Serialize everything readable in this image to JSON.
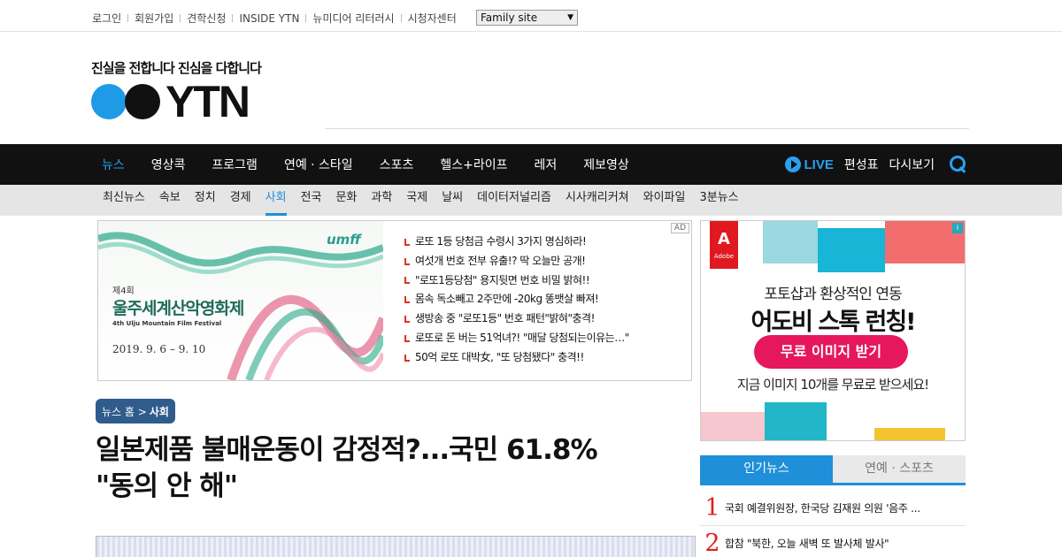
{
  "util_links": [
    "로그인",
    "회원가입",
    "견학신청",
    "INSIDE YTN",
    "뉴미디어 리터러시",
    "시청자센터"
  ],
  "family_site": "Family site",
  "slogan": "진실을 전합니다  진심을 다합니다",
  "brand": "YTN",
  "main_nav": [
    "뉴스",
    "영상콕",
    "프로그램",
    "연예 · 스타일",
    "스포츠",
    "헬스+라이프",
    "레저",
    "제보영상"
  ],
  "main_nav_active": "뉴스",
  "nav_right": {
    "live": "LIVE",
    "schedule": "편성표",
    "replay": "다시보기"
  },
  "sub_nav": [
    "최신뉴스",
    "속보",
    "정치",
    "경제",
    "사회",
    "전국",
    "문화",
    "과학",
    "국제",
    "날씨",
    "데이터저널리즘",
    "시사캐리커쳐",
    "와이파일",
    "3분뉴스"
  ],
  "sub_nav_active": "사회",
  "banner_ad": {
    "fest_logo": "umff",
    "fest_edition": "제4회",
    "fest_title": "울주세계산악영화제",
    "fest_en": "4th Ulju Mountain Film Festival",
    "fest_date": "2019. 9. 6 – 9. 10",
    "tag": "AD",
    "items": [
      "로또 1등 당첨금 수령시 3가지 명심하라!",
      "여섯개 번호 전부 유출!? 딱 오늘만 공개!",
      "\"로또1등당첨\" 용지뒷면 번호 비밀 밝혀!!",
      "몸속 독소빼고 2주만에 -20kg 똥뱃살 빠져!",
      "생방송 중 \"로또1등\" 번호 패턴\"밝혀\"충격!",
      "로또로 돈 버는 51억녀?! \"매달 당첨되는이유는…\"",
      "50억 로또 대박女, \"또 당첨됐다\" 충격!!"
    ]
  },
  "breadcrumb": {
    "home": "뉴스 홈 >",
    "section": "사회"
  },
  "headline_line1": "일본제품 불매운동이 감정적?...국민 61.8%",
  "headline_line2": "\"동의 안 해\"",
  "side_ad": {
    "brand": "Adobe",
    "line1": "포토샵과 환상적인 연동",
    "line2": "어도비 스톡 런칭!",
    "button": "무료 이미지 받기",
    "line3": "지금 이미지 10개를 무료로 받으세요!"
  },
  "pop_tabs": [
    "인기뉴스",
    "연예 · 스포츠"
  ],
  "popular": [
    {
      "rank": "1",
      "title": "국회 예결위원장, 한국당 김재원 의원 '음주 ..."
    },
    {
      "rank": "2",
      "title": "합참 \"북한, 오늘 새벽 또 발사체 발사\""
    }
  ],
  "colors": {
    "accent": "#1e8fd8",
    "nav_bg": "#111111",
    "rank": "#e02020"
  }
}
